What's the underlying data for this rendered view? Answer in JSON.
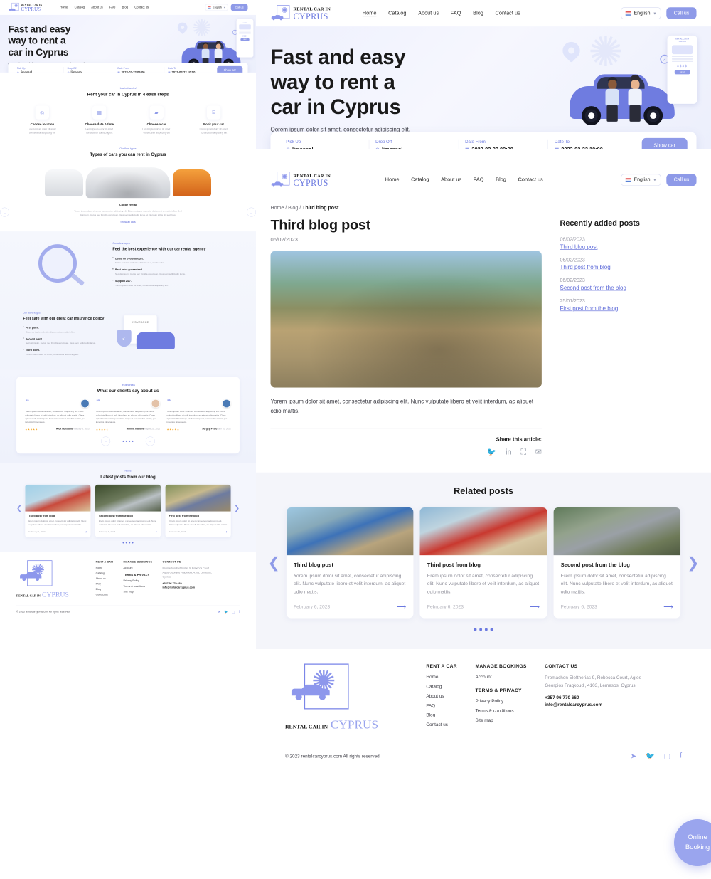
{
  "site": {
    "brand_line1": "RENTAL CAR IN",
    "brand_line2": "CYPRUS",
    "accent": "#6b79e0",
    "button_bg": "#8e9ae8"
  },
  "nav": {
    "links": [
      {
        "label": "Home",
        "active": true
      },
      {
        "label": "Catalog",
        "active": false
      },
      {
        "label": "About us",
        "active": false
      },
      {
        "label": "FAQ",
        "active": false
      },
      {
        "label": "Blog",
        "active": false
      },
      {
        "label": "Contact us",
        "active": false
      }
    ],
    "language": "English",
    "call_button": "Call us"
  },
  "hero": {
    "title_line1": "Fast and easy",
    "title_line2": "way to rent a",
    "title_line3": "car in Cyprus",
    "subtitle": "Qorem ipsum dolor sit amet, consectetur adipiscing elit. Nunc vulputate libero et",
    "phone_brand1": "RENTAL CAR IN",
    "phone_brand2": "CYPRUS",
    "phone_price": "$$$$",
    "phone_button": "RENT"
  },
  "booking": {
    "fields": [
      {
        "label": "Pick Up",
        "value": "limassol",
        "icon": "location-pin-icon"
      },
      {
        "label": "Drop Off",
        "value": "limassol",
        "icon": "location-pin-icon"
      },
      {
        "label": "Date From",
        "value": "2023-02-22 09:00",
        "icon": "calendar-icon"
      },
      {
        "label": "Date To",
        "value": "2023-02-22 10:00",
        "icon": "calendar-icon"
      }
    ],
    "submit": "Show car"
  },
  "steps_section": {
    "tag": "How is it works?",
    "title": "Rent your car in Cyprus in 4 ease steps",
    "steps": [
      {
        "icon": "location-pin-icon",
        "glyph": "◎",
        "title": "Choose location",
        "desc": "Lorem ipsum dolor sit amet, consectetur adipiscing elit"
      },
      {
        "icon": "calendar-icon",
        "glyph": "▦",
        "title": "Choose date & time",
        "desc": "Lorem ipsum dolor sit amet, consectetur adipiscing elit"
      },
      {
        "icon": "car-icon",
        "glyph": "▰",
        "title": "Choose a car",
        "desc": "Lorem ipsum dolor sit amet, consectetur adipiscing elit"
      },
      {
        "icon": "money-icon",
        "glyph": "⌸",
        "title": "Book your car",
        "desc": "Lorem ipsum dolor sit amet, consectetur adipiscing elit"
      }
    ]
  },
  "fleet_section": {
    "tag": "Our fleet types",
    "title": "Types of cars you can rent in Cyprus",
    "car_title": "Coupe rental",
    "car_desc": "Yorem ipsum dolor sit amet, consectetur adipiscing elit. Etiam eu turpis molestie, dictum est a, mattis tellus. Sed dignissim, metus nec fringilla accumsan, risus sem sollicitudin lacus, ut interdum tellus elit sed risus.",
    "show_all": "Show all cars"
  },
  "advantage1": {
    "tag": "Our advantages",
    "title": "Feel the best experience with our car rental agency",
    "points": [
      {
        "title": "Deals for every budget.",
        "desc": "Etiam eu turpis molestie, dictum est a, mattis tellus."
      },
      {
        "title": "Best price guaranteed.",
        "desc": "Sed dignissim, metus nec fringilla accumsan, risus sem sollicitudin lacus."
      },
      {
        "title": "Support 24/7.",
        "desc": "Yorem ipsum dolor sit amet, consectetur adipiscing elit."
      }
    ]
  },
  "advantage2": {
    "tag": "Our advantages",
    "title": "Feel safe with our great car insurance policy",
    "insurance_label": "INSURANCE",
    "points": [
      {
        "title": "First point.",
        "desc": "Etiam eu turpis molestie, dictum est a, mattis tellus."
      },
      {
        "title": "Second point.",
        "desc": "Sed dignissim, metus nec fringilla accumsan, risus sem sollicitudin lacus."
      },
      {
        "title": "Third point.",
        "desc": "Yorem ipsum dolor sit amet, consectetur adipiscing elit."
      }
    ]
  },
  "testimonials": {
    "tag": "Testimonials",
    "title": "What our clients say about us",
    "items": [
      {
        "text": "Torem ipsum dolor sit amet, consectetur adipiscing elit. Nunc vulputate libero et velit interdum, ac aliquet odio mattis. Class aptent taciti sociosqu ad litora torquent per conubia nostra, per inceptos himenaeos.",
        "stars": "★★★★★",
        "name": "Rick Nurslund",
        "date": "February 3, 2023"
      },
      {
        "text": "Torem ipsum dolor sit amet, consectetur adipiscing elit. Nunc vulputate libero et velit interdum, ac aliquet odio mattis. Class aptent taciti sociosqu ad litora torquent per conubia nostra, per inceptos himenaeos.",
        "stars": "★★★★☆",
        "name": "Rimma Ivanova",
        "date": "August 25, 2022"
      },
      {
        "text": "Torem ipsum dolor sit amet, consectetur adipiscing elit. Nunc vulputate libero et velit interdum, ac aliquet odio mattis. Class aptent taciti sociosqu ad litora torquent per conubia nostra, per inceptos himenaeos.",
        "stars": "★★★★★",
        "name": "Sergey Petro",
        "date": "June 10, 2022"
      }
    ]
  },
  "latest_posts": {
    "tag": "News",
    "title": "Latest posts from our blog",
    "items": [
      {
        "title": "Third post from blog",
        "desc": "Erem ipsum dolor sit amet, consectetur adipiscing elit. Nunc vulputate libero et velit interdum, ac aliquet odio mattis",
        "date": "February 6, 2023"
      },
      {
        "title": "Second post from the blog",
        "desc": "Erem ipsum dolor sit amet, consectetur adipiscing elit. Nunc vulputate libero et velit interdum, ac aliquet odio mattis",
        "date": "February 6, 2023"
      },
      {
        "title": "First post from the blog",
        "desc": "Yorem ipsum dolor sit amet, consectetur adipiscing elit. Nunc vulputate libero et velit interdum, ac aliquet odio mattis",
        "date": "January 25, 2023"
      }
    ]
  },
  "breadcrumb": {
    "home": "Home",
    "sep1": "/",
    "blog": "Blog",
    "sep2": "/",
    "current": "Third blog post"
  },
  "post": {
    "title": "Third blog post",
    "date": "06/02/2023",
    "body": "Yorem ipsum dolor sit amet, consectetur adipiscing elit. Nunc vulputate libero et velit interdum, ac aliquet odio mattis.",
    "share_label": "Share this article:",
    "share_icons": [
      "twitter-icon",
      "linkedin-icon",
      "facebook-icon",
      "email-icon"
    ]
  },
  "sidebar": {
    "title": "Recently added posts",
    "items": [
      {
        "date": "06/02/2023",
        "title": "Third blog post"
      },
      {
        "date": "06/02/2023",
        "title": "Third post from blog"
      },
      {
        "date": "06/02/2023",
        "title": "Second post from the blog"
      },
      {
        "date": "25/01/2023",
        "title": "First post from the blog"
      }
    ]
  },
  "related": {
    "title": "Related posts",
    "items": [
      {
        "title": "Third blog post",
        "desc": "Yorem ipsum dolor sit amet, consectetur adipiscing elit. Nunc vulputate libero et velit interdum, ac aliquet odio mattis.",
        "date": "February 6, 2023"
      },
      {
        "title": "Third post from blog",
        "desc": "Erem ipsum dolor sit amet, consectetur adipiscing elit. Nunc vulputate libero et velit interdum, ac aliquet odio mattis.",
        "date": "February 6, 2023"
      },
      {
        "title": "Second post from the blog",
        "desc": "Erem ipsum dolor sit amet, consectetur adipiscing elit. Nunc vulputate libero et velit interdum, ac aliquet odio mattis.",
        "date": "February 6, 2023"
      }
    ]
  },
  "footer": {
    "col1_title": "RENT A CAR",
    "col1_links": [
      "Home",
      "Catalog",
      "About us",
      "FAQ",
      "Blog",
      "Contact us"
    ],
    "col2_title": "MANAGE BOOKINGS",
    "col2_links": [
      "Account"
    ],
    "col2b_title": "TERMS & PRIVACY",
    "col2b_links": [
      "Privacy Policy",
      "Terms & conditions",
      "Site map"
    ],
    "col3_title": "CONTACT US",
    "address": "Promachon Eleftherias 9, Rebecca Court, Agios Georgios Fragkoudi, 4103, Lemesos, Cyprus",
    "phone": "+357 96 770 660",
    "email": "info@rentalcarcyprus.com",
    "copyright": "© 2023 rentalcarcyprus.com All rights reserved.",
    "socials": [
      "telegram-icon",
      "twitter-icon",
      "instagram-icon",
      "facebook-icon"
    ]
  },
  "fab": {
    "line1": "Online",
    "line2": "Booking"
  }
}
